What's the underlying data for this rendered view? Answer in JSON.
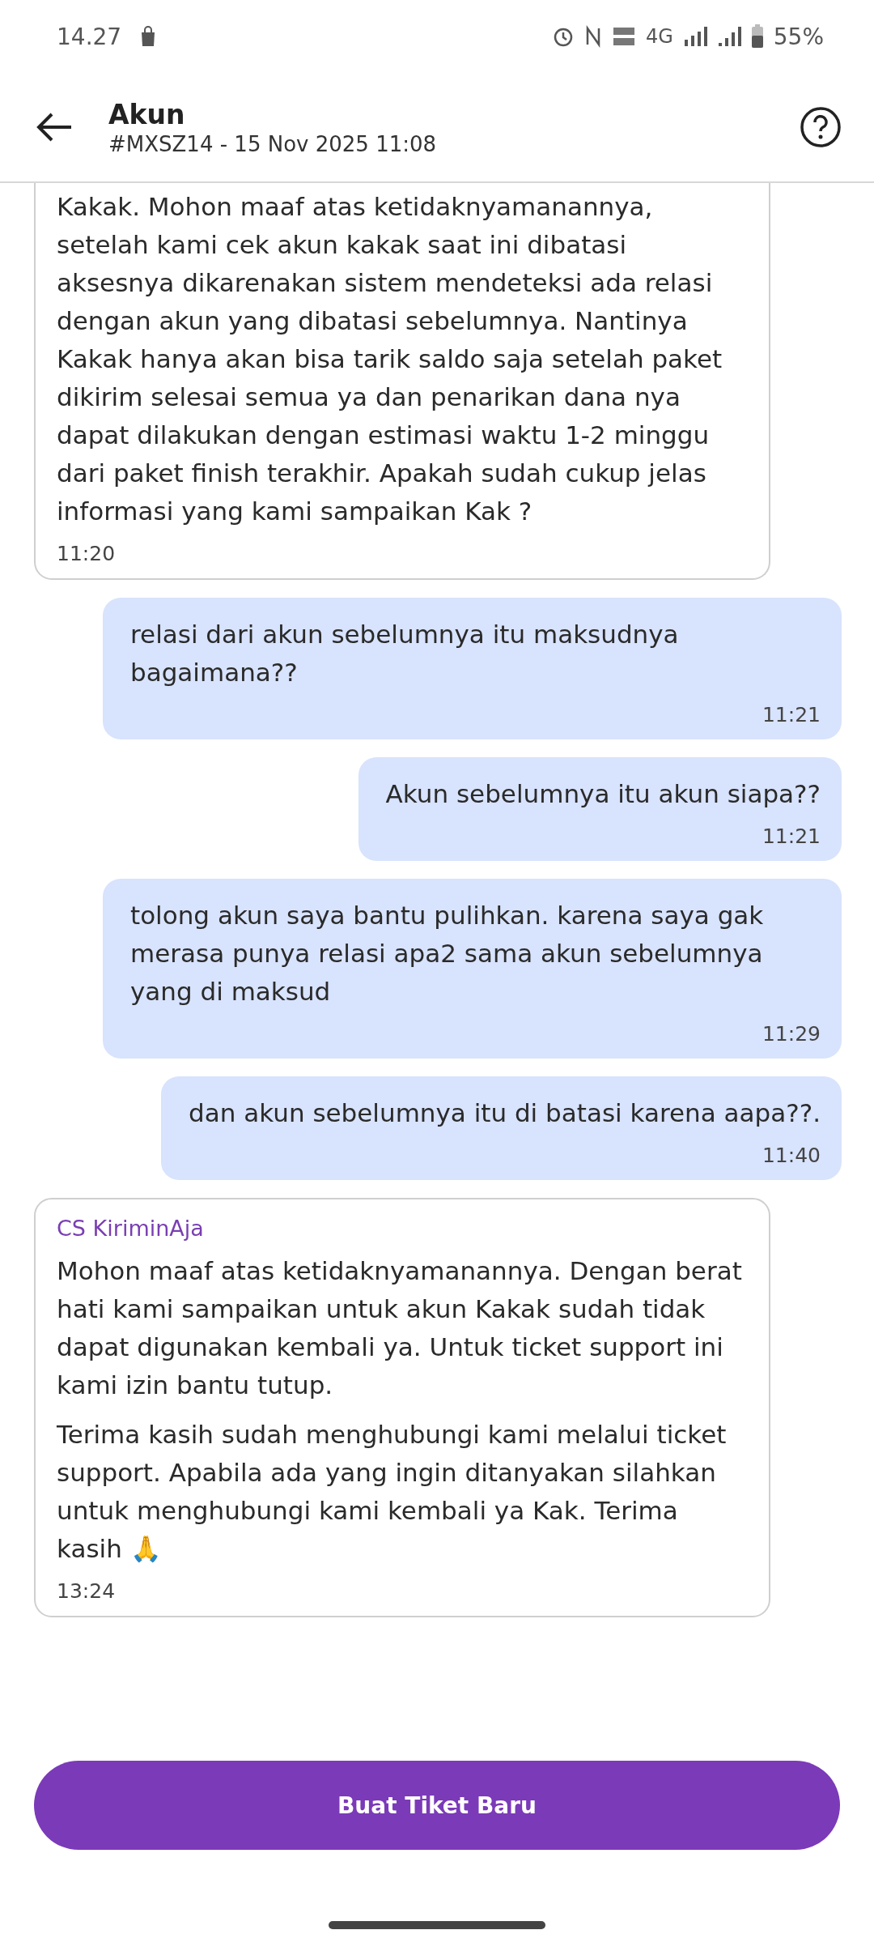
{
  "status_bar": {
    "time": "14.27",
    "network": "4G",
    "battery": "55%"
  },
  "header": {
    "title": "Akun",
    "subtitle": "#MXSZ14 - 15 Nov 2025 11:08"
  },
  "messages": [
    {
      "kind": "agent",
      "cut_top": true,
      "paragraphs": [
        "Kakak. Mohon maaf atas ketidaknyamanannya, setelah kami cek akun kakak saat ini dibatasi aksesnya dikarenakan sistem mendeteksi ada relasi dengan akun yang dibatasi sebelumnya. Nantinya Kakak hanya akan bisa tarik saldo saja setelah paket dikirim selesai semua ya dan penarikan dana nya dapat dilakukan dengan estimasi waktu 1-2 minggu dari paket finish terakhir. Apakah sudah cukup jelas informasi yang kami sampaikan Kak ?"
      ],
      "time": "11:20"
    },
    {
      "kind": "user",
      "paragraphs": [
        "relasi dari akun sebelumnya itu maksudnya bagaimana??"
      ],
      "time": "11:21"
    },
    {
      "kind": "user",
      "paragraphs": [
        "Akun sebelumnya itu akun siapa??"
      ],
      "time": "11:21"
    },
    {
      "kind": "user",
      "paragraphs": [
        "tolong akun saya bantu pulihkan. karena saya gak merasa punya relasi apa2 sama akun sebelumnya yang di maksud"
      ],
      "time": "11:29"
    },
    {
      "kind": "user",
      "paragraphs": [
        "dan akun sebelumnya itu di batasi karena aapa??."
      ],
      "time": "11:40"
    },
    {
      "kind": "agent",
      "cut_top": false,
      "sender": "CS KiriminAja",
      "paragraphs": [
        "Mohon maaf atas ketidaknyamanannya. Dengan berat hati kami sampaikan untuk akun Kakak sudah tidak dapat digunakan kembali ya. Untuk ticket support ini kami izin bantu tutup.",
        "Terima kasih sudah menghubungi kami melalui ticket support. Apabila ada yang ingin ditanyakan silahkan untuk menghubungi kami kembali ya Kak. Terima kasih 🙏"
      ],
      "time": "13:24"
    }
  ],
  "button": "Buat Tiket Baru"
}
